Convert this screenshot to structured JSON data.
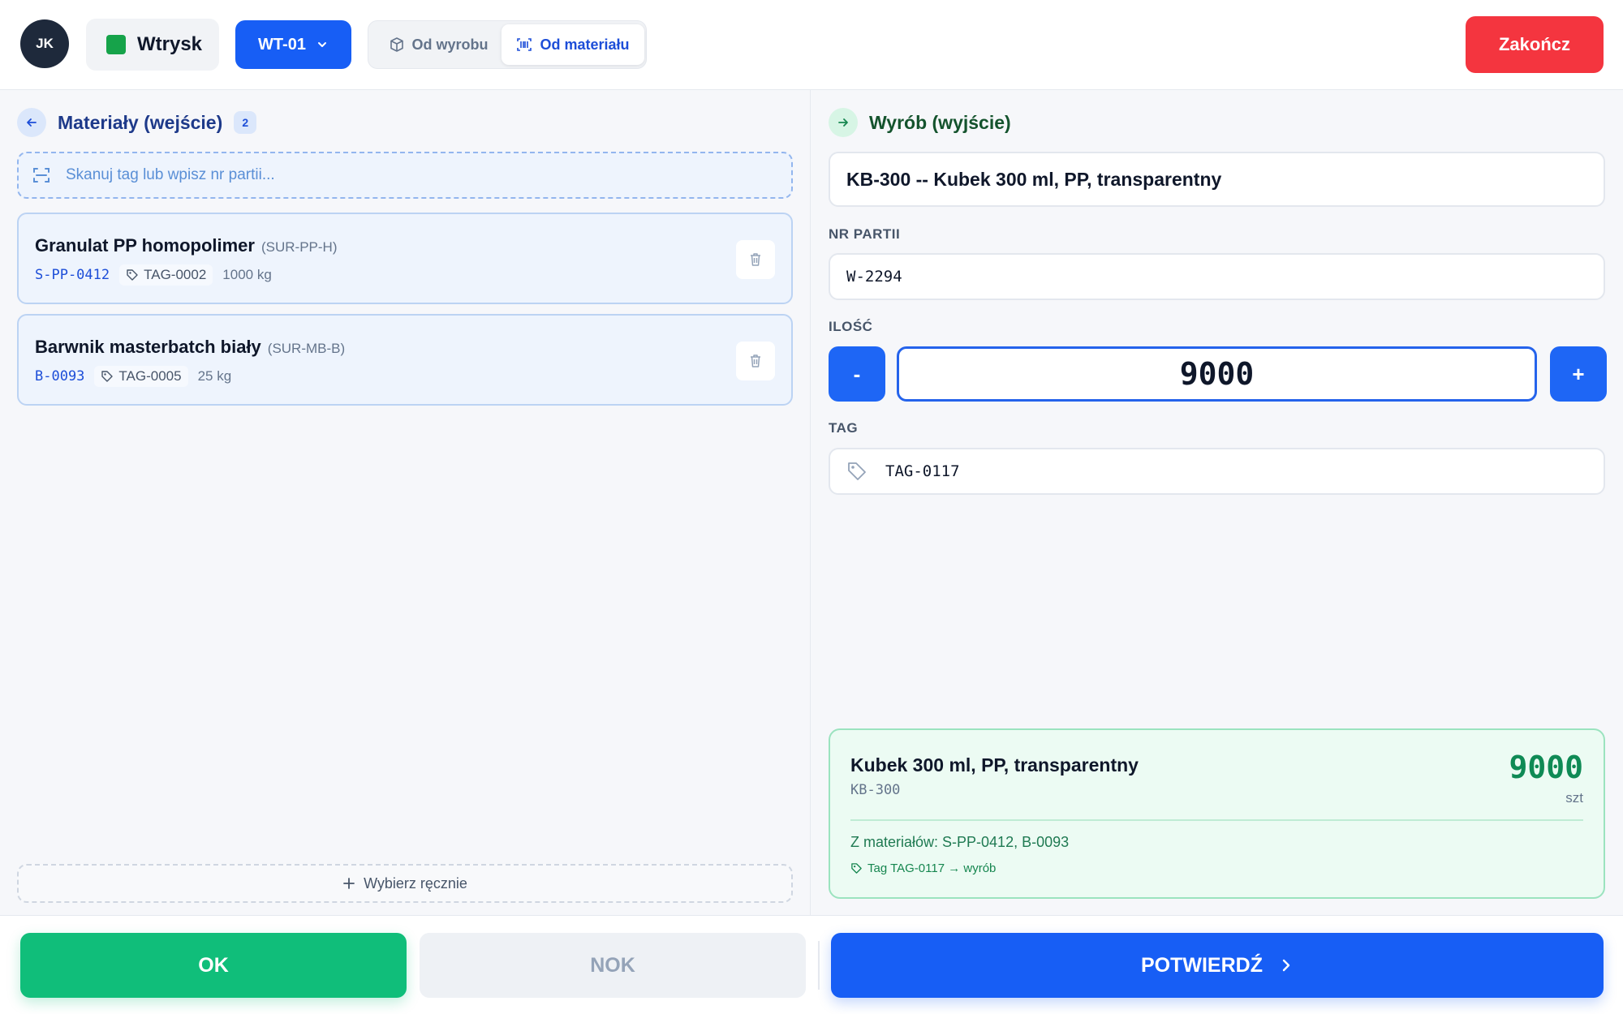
{
  "header": {
    "user_initials": "JK",
    "process": {
      "label": "Wtrysk",
      "color": "#16a34a"
    },
    "machine": {
      "label": "WT-01",
      "icon": "chevron-down-icon"
    },
    "modes": [
      {
        "label": "Od wyrobu",
        "icon": "box-icon",
        "active": false
      },
      {
        "label": "Od materiału",
        "icon": "barcode-icon",
        "active": true
      }
    ],
    "end_label": "Zakończ"
  },
  "materials": {
    "title": "Materiały (wejście)",
    "count": "2",
    "scan_placeholder": "Skanuj tag lub wpisz nr partii...",
    "items": [
      {
        "name": "Granulat PP homopolimer",
        "code": "(SUR-PP-H)",
        "lot": "S-PP-0412",
        "tag": "TAG-0002",
        "qty": "1000 kg"
      },
      {
        "name": "Barwnik masterbatch biały",
        "code": "(SUR-MB-B)",
        "lot": "B-0093",
        "tag": "TAG-0005",
        "qty": "25 kg"
      }
    ],
    "manual_label": "Wybierz ręcznie"
  },
  "product": {
    "title": "Wyrób (wyjście)",
    "selected": "KB-300 -- Kubek 300 ml, PP, transparentny",
    "lot_label": "NR PARTII",
    "lot_value": "W-2294",
    "qty_label": "ILOŚĆ",
    "qty_value": "9000",
    "minus_label": "-",
    "plus_label": "+",
    "tag_label": "TAG",
    "tag_value": "TAG-0117"
  },
  "summary": {
    "name": "Kubek 300 ml, PP, transparentny",
    "code": "KB-300",
    "qty": "9000",
    "unit": "szt",
    "from_materials": "Z materiałów: S-PP-0412, B-0093",
    "tag_note": "Tag TAG-0117 → wyrób"
  },
  "actions": {
    "ok": "OK",
    "nok": "NOK",
    "confirm": "POTWIERDŹ"
  },
  "colors": {
    "primary": "#175ef5",
    "danger": "#f4353f",
    "success": "#10be7a"
  }
}
